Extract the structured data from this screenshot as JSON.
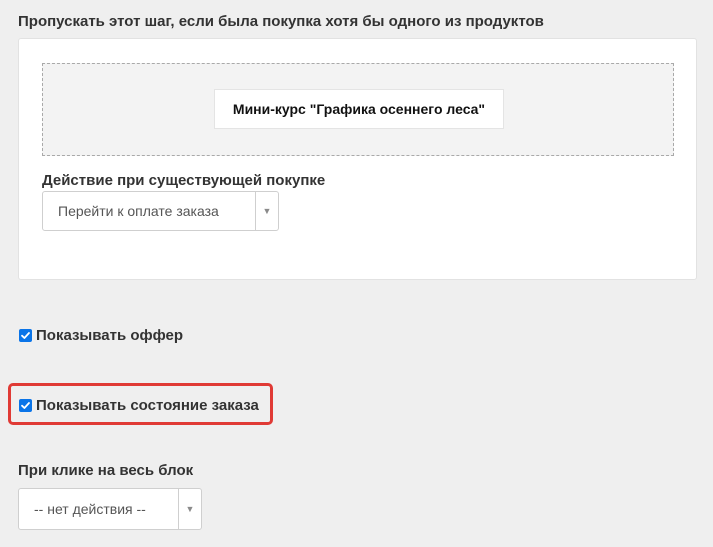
{
  "skip_section": {
    "title": "Пропускать этот шаг, если была покупка хотя бы одного из продуктов",
    "product_chip": "Мини-курс \"Графика осеннего леса\"",
    "action_label": "Действие при существующей покупке",
    "action_select_value": "Перейти к оплате заказа"
  },
  "options": {
    "show_offer": {
      "label": "Показывать оффер",
      "checked": true
    },
    "show_order_state": {
      "label": "Показывать состояние заказа",
      "checked": true,
      "highlighted": true
    }
  },
  "block_click": {
    "label": "При клике на весь блок",
    "select_value": "-- нет действия --"
  },
  "colors": {
    "checkbox": "#0a74e8",
    "highlight": "#e03a35",
    "background": "#efefef"
  },
  "icons": {
    "select_arrow": "chevron-down-icon",
    "checkmark": "checkmark-icon"
  }
}
